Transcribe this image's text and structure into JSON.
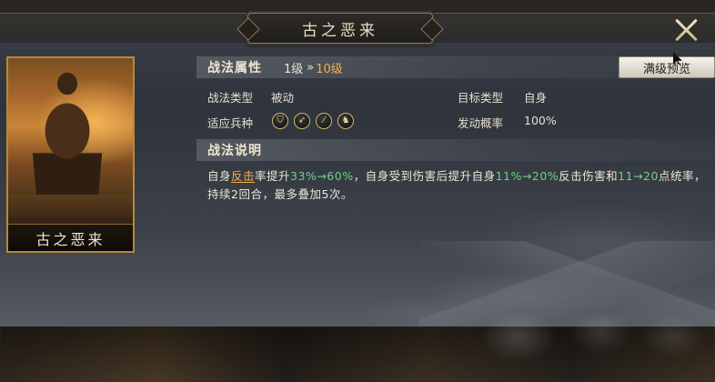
{
  "header": {
    "title": "古之恶来"
  },
  "card": {
    "name": "古之恶来"
  },
  "attributes": {
    "section_title": "战法属性",
    "level_from": "1级",
    "level_arrow": "»",
    "level_to": "10级",
    "preview_button": "满级预览"
  },
  "info": {
    "type_label": "战法类型",
    "type_value": "被动",
    "target_label": "目标类型",
    "target_value": "自身",
    "troops_label": "适应兵种",
    "chance_label": "发动概率",
    "chance_value": "100%",
    "troops": [
      {
        "name": "shield-icon",
        "glyph": "⛉"
      },
      {
        "name": "bow-icon",
        "glyph": "➶"
      },
      {
        "name": "spear-icon",
        "glyph": "⁄"
      },
      {
        "name": "horse-icon",
        "glyph": "♞"
      }
    ]
  },
  "description": {
    "section_title": "战法说明",
    "parts": {
      "p1": "自身",
      "p2": "反击",
      "p3": "率提升",
      "p4": "33%→60%",
      "p5": "，自身受到伤害后提升自身",
      "p6": "11%→20%",
      "p7": "反击伤害和",
      "p8": "11→20",
      "p9": "点统率，持续2回合，最多叠加5次。"
    }
  },
  "colors": {
    "highlight_orange": "#f2b048",
    "highlight_green": "#6fd08a",
    "card_border": "#b38a3e"
  }
}
